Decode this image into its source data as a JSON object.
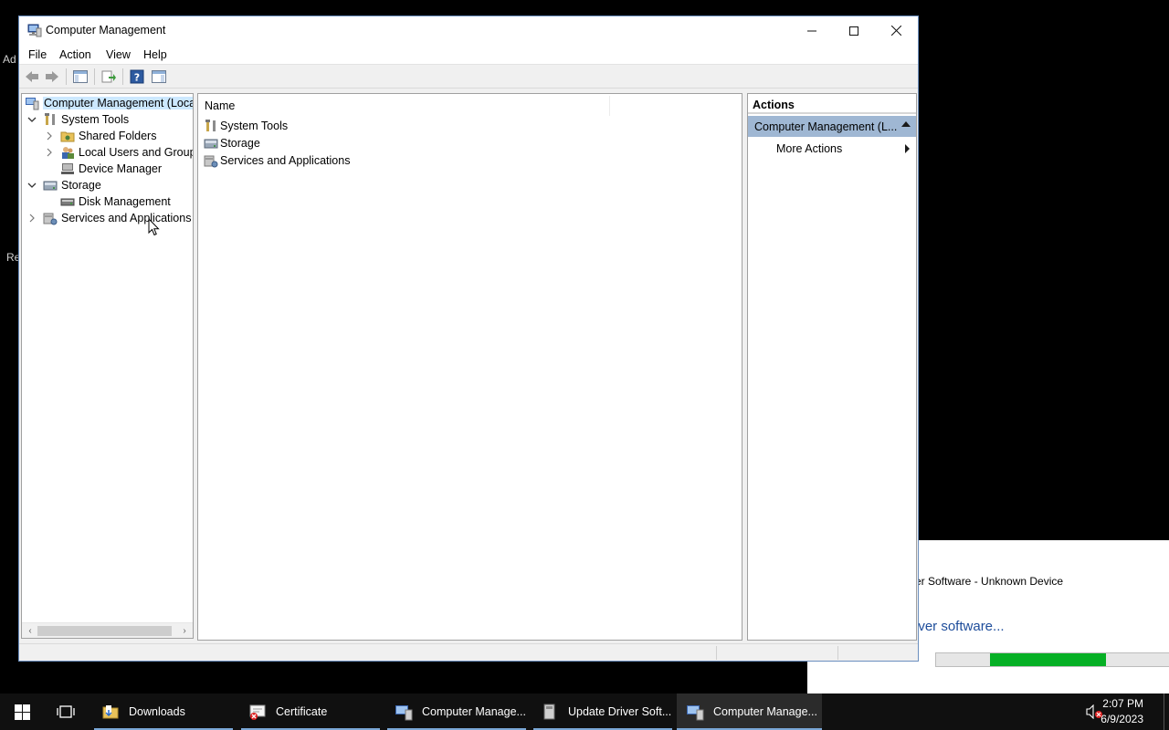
{
  "window": {
    "title": "Computer Management",
    "menu": [
      "File",
      "Action",
      "View",
      "Help"
    ]
  },
  "tree": {
    "nodes": [
      {
        "label": "Computer Management (Local",
        "selected": true
      },
      {
        "label": "System Tools",
        "expanded": true
      },
      {
        "label": "Shared Folders"
      },
      {
        "label": "Local Users and Groups"
      },
      {
        "label": "Device Manager"
      },
      {
        "label": "Storage",
        "expanded": true
      },
      {
        "label": "Disk Management"
      },
      {
        "label": "Services and Applications"
      }
    ]
  },
  "content": {
    "column_name": "Name",
    "items": [
      "System Tools",
      "Storage",
      "Services and Applications"
    ]
  },
  "actions": {
    "header": "Actions",
    "selected": "Computer Management (L...",
    "more": "More Actions"
  },
  "background_dialog": {
    "title_fragment": "er Software - Unknown Device",
    "status_fragment": "iver software...",
    "progress_fill_start": 0.23,
    "progress_fill_end": 0.72
  },
  "taskbar": {
    "items": [
      "Downloads",
      "Certificate",
      "Computer Manage...",
      "Update Driver Soft...",
      "Computer Manage..."
    ],
    "time": "2:07 PM",
    "date": "6/9/2023"
  },
  "colors": {
    "selection": "#cce8ff",
    "actions_selected": "#9fb7d3",
    "progress_green": "#06b025",
    "taskbar": "#101010"
  }
}
